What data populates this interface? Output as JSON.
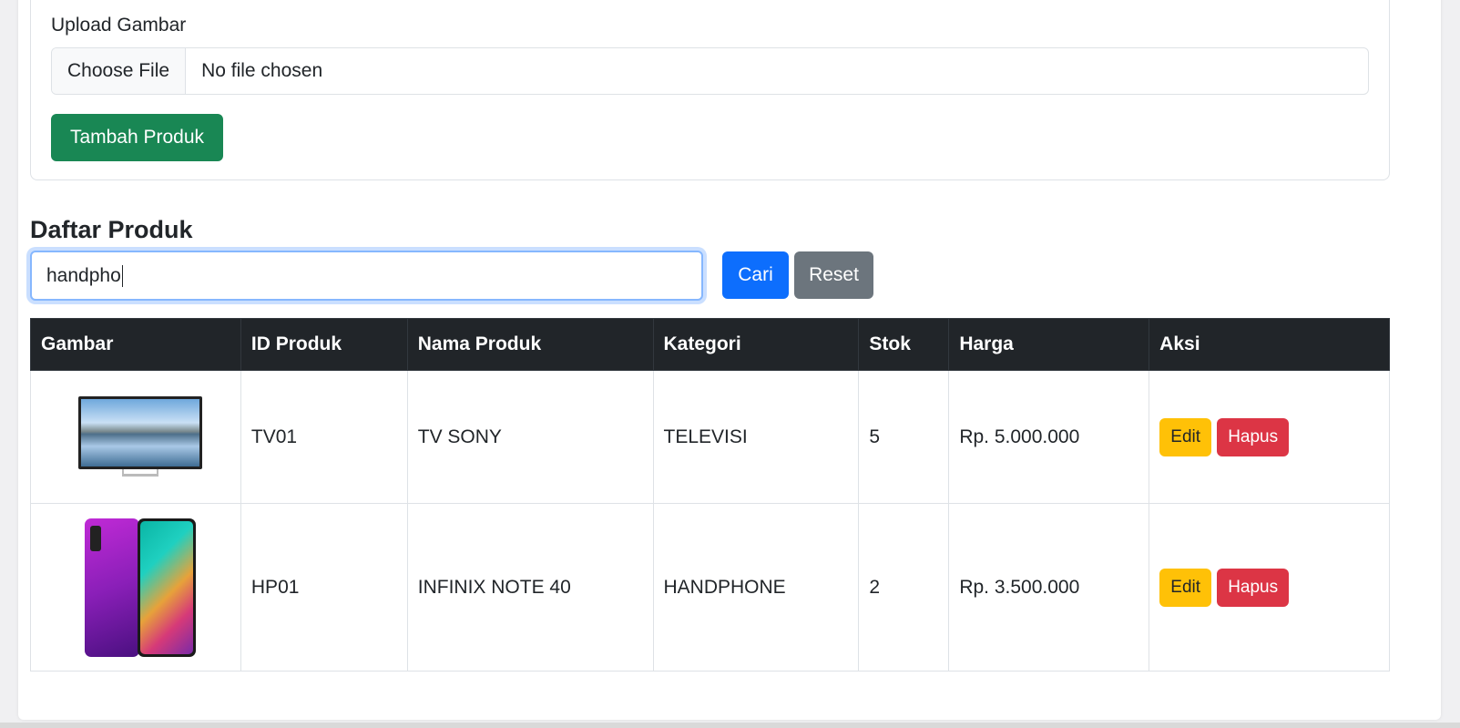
{
  "form": {
    "upload_label": "Upload Gambar",
    "file_button": "Choose File",
    "file_status": "No file chosen",
    "submit_label": "Tambah Produk"
  },
  "list": {
    "title": "Daftar Produk",
    "search_value": "handpho",
    "search_button": "Cari",
    "reset_button": "Reset"
  },
  "table": {
    "headers": [
      "Gambar",
      "ID Produk",
      "Nama Produk",
      "Kategori",
      "Stok",
      "Harga",
      "Aksi"
    ],
    "rows": [
      {
        "image_icon": "tv-product-image",
        "id": "TV01",
        "name": "TV SONY",
        "category": "TELEVISI",
        "stock": "5",
        "price": "Rp. 5.000.000",
        "edit": "Edit",
        "delete": "Hapus"
      },
      {
        "image_icon": "phone-product-image",
        "id": "HP01",
        "name": "INFINIX NOTE 40",
        "category": "HANDPHONE",
        "stock": "2",
        "price": "Rp. 3.500.000",
        "edit": "Edit",
        "delete": "Hapus"
      }
    ]
  },
  "colors": {
    "success": "#198754",
    "primary": "#0d6efd",
    "secondary": "#6c757d",
    "warning": "#ffc107",
    "danger": "#dc3545",
    "table_header": "#212529"
  }
}
